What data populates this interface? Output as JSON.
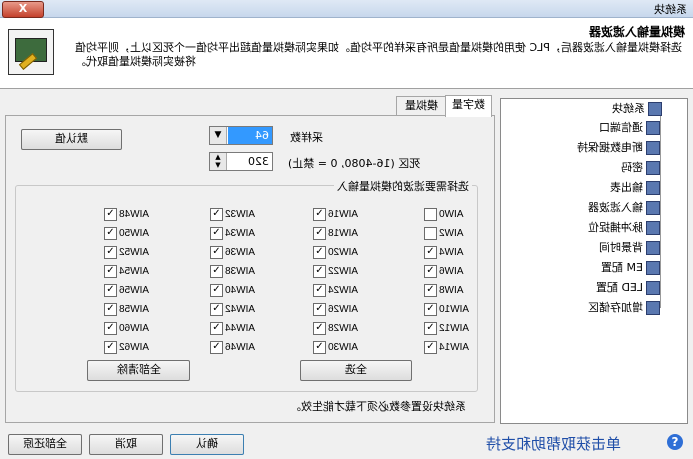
{
  "window": {
    "title": "系统块",
    "close_label": "X"
  },
  "header": {
    "title": "模拟量输入滤波器",
    "description": "选择模拟量输入滤波器后，PLC 使用的模拟量值是所有采样的平均值。如果实际模拟量值超出平均值一个死区以上，则平均值将被实际模拟量值取代。"
  },
  "tabs": [
    {
      "label": "数字量"
    },
    {
      "label": "模拟量"
    }
  ],
  "settings": {
    "default_button": "默认值",
    "samples_label": "采样数",
    "samples_value": "64",
    "deadband_label": "死区 (16-4080, 0 = 禁止)",
    "deadband_value": "320"
  },
  "group": {
    "title": "选择需要滤波的模拟量输入",
    "channels": [
      {
        "name": "AIW0",
        "checked": false
      },
      {
        "name": "AIW2",
        "checked": false
      },
      {
        "name": "AIW4",
        "checked": true
      },
      {
        "name": "AIW6",
        "checked": true
      },
      {
        "name": "AIW8",
        "checked": true
      },
      {
        "name": "AIW10",
        "checked": true
      },
      {
        "name": "AIW12",
        "checked": true
      },
      {
        "name": "AIW14",
        "checked": true
      },
      {
        "name": "AIW16",
        "checked": true
      },
      {
        "name": "AIW18",
        "checked": true
      },
      {
        "name": "AIW20",
        "checked": true
      },
      {
        "name": "AIW22",
        "checked": true
      },
      {
        "name": "AIW24",
        "checked": true
      },
      {
        "name": "AIW26",
        "checked": true
      },
      {
        "name": "AIW28",
        "checked": true
      },
      {
        "name": "AIW30",
        "checked": true
      },
      {
        "name": "AIW32",
        "checked": true
      },
      {
        "name": "AIW34",
        "checked": true
      },
      {
        "name": "AIW36",
        "checked": true
      },
      {
        "name": "AIW38",
        "checked": true
      },
      {
        "name": "AIW40",
        "checked": true
      },
      {
        "name": "AIW42",
        "checked": true
      },
      {
        "name": "AIW44",
        "checked": true
      },
      {
        "name": "AIW46",
        "checked": true
      },
      {
        "name": "AIW48",
        "checked": true
      },
      {
        "name": "AIW50",
        "checked": true
      },
      {
        "name": "AIW52",
        "checked": true
      },
      {
        "name": "AIW54",
        "checked": true
      },
      {
        "name": "AIW56",
        "checked": true
      },
      {
        "name": "AIW58",
        "checked": true
      },
      {
        "name": "AIW60",
        "checked": true
      },
      {
        "name": "AIW62",
        "checked": true
      }
    ],
    "select_all": "全选",
    "clear_all": "全部清除"
  },
  "note": "系统块设置参数必须下载才能生效。",
  "tree": {
    "root": "系统块",
    "items": [
      {
        "label": "通信端口"
      },
      {
        "label": "断电数据保持"
      },
      {
        "label": "密码"
      },
      {
        "label": "输出表"
      },
      {
        "label": "输入滤波器"
      },
      {
        "label": "脉冲捕捉位"
      },
      {
        "label": "背景时间"
      },
      {
        "label": "EM 配置"
      },
      {
        "label": "LED 配置"
      },
      {
        "label": "增加存储区"
      }
    ]
  },
  "footer": {
    "help": "单击获取帮助和支持",
    "ok": "确认",
    "cancel": "取消",
    "restore_all": "全部还原"
  }
}
